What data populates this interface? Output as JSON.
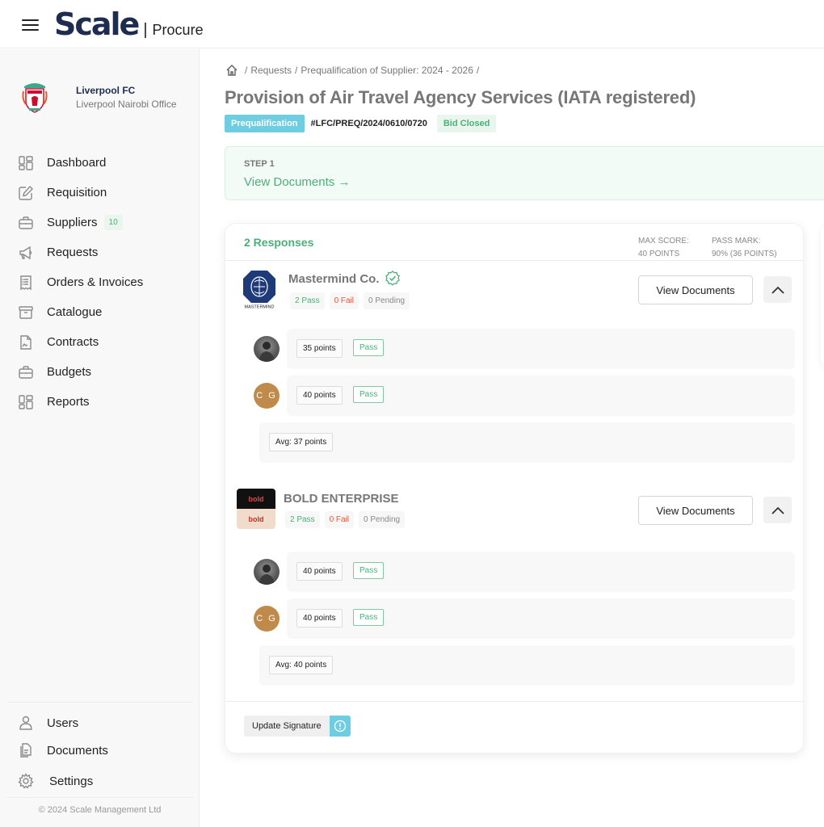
{
  "header": {
    "brand": "Scale",
    "separator": "|",
    "product": "Procure"
  },
  "org": {
    "name": "Liverpool FC",
    "office": "Liverpool Nairobi Office"
  },
  "sidebar": {
    "items": [
      {
        "label": "Dashboard",
        "icon": "dashboard-icon"
      },
      {
        "label": "Requisition",
        "icon": "edit-icon"
      },
      {
        "label": "Suppliers",
        "icon": "briefcase-icon",
        "badge": "10"
      },
      {
        "label": "Requests",
        "icon": "megaphone-icon"
      },
      {
        "label": "Orders & Invoices",
        "icon": "receipt-icon"
      },
      {
        "label": "Catalogue",
        "icon": "archive-icon"
      },
      {
        "label": "Contracts",
        "icon": "contract-icon"
      },
      {
        "label": "Budgets",
        "icon": "briefcase-icon"
      },
      {
        "label": "Reports",
        "icon": "reports-icon"
      }
    ],
    "bottom_items": [
      {
        "label": "Users",
        "icon": "user-icon"
      },
      {
        "label": "Documents",
        "icon": "documents-icon"
      },
      {
        "label": "Settings",
        "icon": "gear-icon"
      }
    ],
    "copyright": "© 2024 Scale Management Ltd"
  },
  "breadcrumb": {
    "items": [
      "Requests",
      "Prequalification of Supplier: 2024 - 2026"
    ],
    "separator": "/"
  },
  "page": {
    "title": "Provision of Air Travel Agency Services (IATA registered)",
    "type_tag": "Prequalification",
    "reference": "#LFC/PREQ/2024/0610/0720",
    "status": "Bid Closed"
  },
  "step": {
    "label": "STEP 1",
    "link": "View Documents →"
  },
  "responses": {
    "title": "2 Responses",
    "max_score_label": "MAX SCORE:",
    "max_score_value": "40 POINTS",
    "pass_mark_label": "PASS MARK:",
    "pass_mark_value": "90% (36 POINTS)",
    "suppliers": [
      {
        "name": "Mastermind Co.",
        "logo_text": "MASTERMIND",
        "verified": true,
        "pass": "2 Pass",
        "fail": "0 Fail",
        "pending": "0 Pending",
        "view_docs": "View Documents",
        "evaluations": [
          {
            "avatar": "photo",
            "points": "35 points",
            "result": "Pass"
          },
          {
            "avatar": "C G",
            "points": "40 points",
            "result": "Pass"
          }
        ],
        "average": "Avg: 37 points"
      },
      {
        "name": "BOLD ENTERPRISE",
        "logo_text": "bold",
        "verified": false,
        "pass": "2 Pass",
        "fail": "0 Fail",
        "pending": "0 Pending",
        "view_docs": "View Documents",
        "evaluations": [
          {
            "avatar": "photo",
            "points": "40 points",
            "result": "Pass"
          },
          {
            "avatar": "C G",
            "points": "40 points",
            "result": "Pass"
          }
        ],
        "average": "Avg: 40 points"
      }
    ],
    "update_signature": "Update Signature"
  },
  "colors": {
    "brand_navy": "#1e2d4f",
    "accent_green": "#4caf78",
    "accent_cyan": "#6ecde0",
    "fail_red": "#e6553a",
    "avatar_brown": "#c08a4a"
  }
}
